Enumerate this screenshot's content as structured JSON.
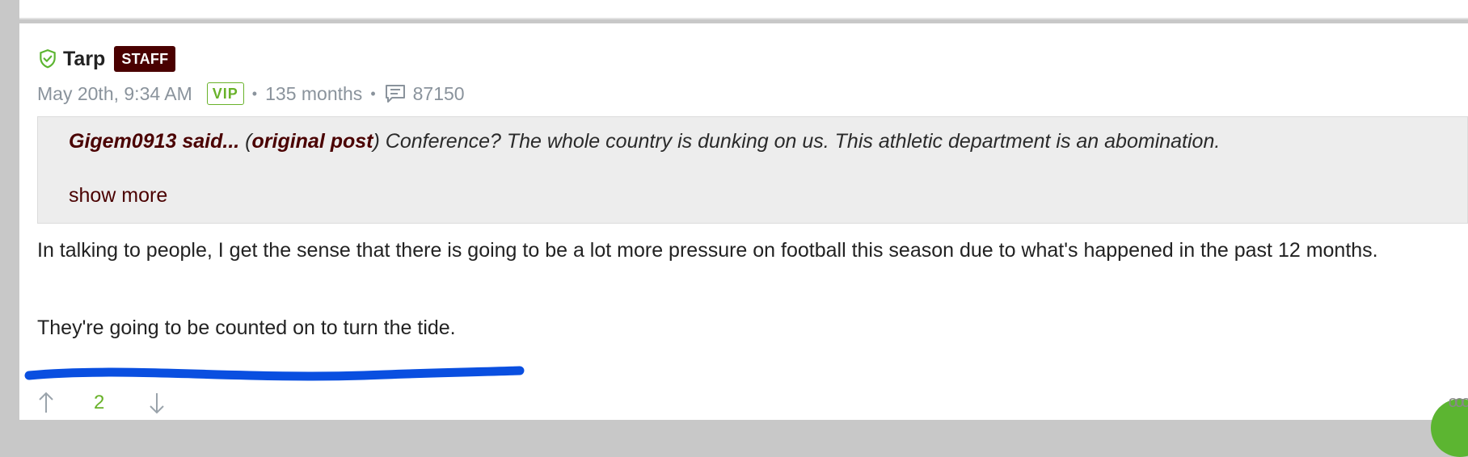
{
  "post": {
    "author": "Tarp",
    "role_badge": "STAFF",
    "date": "May 20th, 9:34 AM",
    "tier_badge": "VIP",
    "separator": "•",
    "tenure": "135 months",
    "post_count": "87150"
  },
  "quote": {
    "author_text": "Gigem0913 said...",
    "open_paren": " (",
    "original_link": "original post",
    "text": ") Conference? The whole country is dunking on us. This athletic department is an abomination.",
    "show_more": "show more"
  },
  "body": {
    "paragraph1": "In talking to people, I get the sense that there is going to be a lot more pressure on football this season due to what's happened in the past 12 months.",
    "paragraph2": "They're going to be counted on to turn the tide."
  },
  "votes": {
    "count": "2"
  },
  "icons": {
    "verified": "shield-check-icon",
    "comments": "comment-icon",
    "upvote": "arrow-up-icon",
    "downvote": "arrow-down-icon",
    "more": "more-options-icon"
  },
  "colors": {
    "brand": "#4a0000",
    "vip_green": "#69b22a",
    "annotation_blue": "#0a4fe0"
  }
}
